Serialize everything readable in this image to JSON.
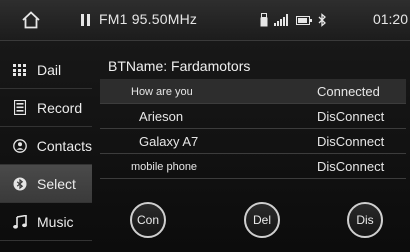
{
  "status_bar": {
    "radio": "FM1 95.50MHz",
    "clock": "01:20"
  },
  "sidebar": {
    "items": [
      {
        "label": "Dail",
        "icon": "dialpad-icon"
      },
      {
        "label": "Record",
        "icon": "call-log-icon"
      },
      {
        "label": "Contacts",
        "icon": "contacts-icon"
      },
      {
        "label": "Select",
        "icon": "bluetooth-icon"
      },
      {
        "label": "Music",
        "icon": "music-note-icon"
      }
    ],
    "active_index": 3
  },
  "bluetooth": {
    "name_label": "BTName: Fardamotors",
    "devices": [
      {
        "name": "How are you",
        "status": "Connected"
      },
      {
        "name": "Arieson",
        "status": "DisConnect"
      },
      {
        "name": "Galaxy A7",
        "status": "DisConnect"
      },
      {
        "name": "mobile phone",
        "status": "DisConnect"
      }
    ]
  },
  "actions": {
    "connect": "Con",
    "delete": "Del",
    "disconnect": "Dis"
  },
  "colors": {
    "background": "#111111",
    "active_item": "#444444",
    "text": "#e8e8e8"
  }
}
